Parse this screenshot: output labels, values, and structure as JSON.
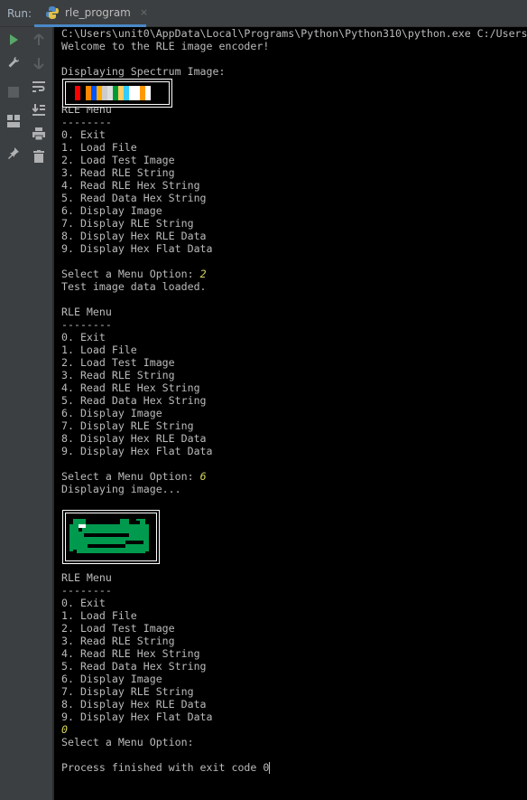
{
  "run_bar": {
    "label": "Run:",
    "tab_label": "rle_program",
    "close": "×"
  },
  "console": {
    "lines": [
      "C:\\Users\\unit0\\AppData\\Local\\Programs\\Python\\Python310\\python.exe C:/Users",
      "Welcome to the RLE image encoder!",
      "",
      "Displaying Spectrum Image:",
      "",
      "",
      "RLE Menu",
      "--------",
      "0. Exit",
      "1. Load File",
      "2. Load Test Image",
      "3. Read RLE String",
      "4. Read RLE Hex String",
      "5. Read Data Hex String",
      "6. Display Image",
      "7. Display RLE String",
      "8. Display Hex RLE Data",
      "9. Display Hex Flat Data",
      "",
      "Select a Menu Option: ",
      "Test image data loaded.",
      "",
      "RLE Menu",
      "--------",
      "0. Exit",
      "1. Load File",
      "2. Load Test Image",
      "3. Read RLE String",
      "4. Read RLE Hex String",
      "5. Read Data Hex String",
      "6. Display Image",
      "7. Display RLE String",
      "8. Display Hex RLE Data",
      "9. Display Hex Flat Data",
      "",
      "Select a Menu Option: ",
      "Displaying image...",
      "",
      "",
      "",
      "",
      "",
      "",
      "RLE Menu",
      "--------",
      "0. Exit",
      "1. Load File",
      "2. Load Test Image",
      "3. Read RLE String",
      "4. Read RLE Hex String",
      "5. Read Data Hex String",
      "6. Display Image",
      "7. Display RLE String",
      "8. Display Hex RLE Data",
      "9. Display Hex Flat Data",
      "",
      "Select a Menu Option: ",
      "",
      "Process finished with exit code 0"
    ],
    "inputs": {
      "19": "2",
      "35": "6",
      "55": "0"
    }
  },
  "spectrum_colors": [
    "#000000",
    "#ff0000",
    "#000000",
    "#ff8800",
    "#0055ff",
    "#ffaa00",
    "#cccccc",
    "#dddddd",
    "#009933",
    "#ffcc66",
    "#33ccff",
    "#ffffff",
    "#ffffff",
    "#ff9900",
    "#ffffff"
  ],
  "icons": {
    "run": "run-icon",
    "wrench": "wrench-icon",
    "up": "arrow-up-icon",
    "down": "arrow-down-icon",
    "stop": "stop-icon",
    "wrap": "soft-wrap-icon",
    "scroll": "scroll-to-end-icon",
    "layout": "layout-icon",
    "print": "print-icon",
    "pin": "pin-icon",
    "trash": "trash-icon"
  }
}
